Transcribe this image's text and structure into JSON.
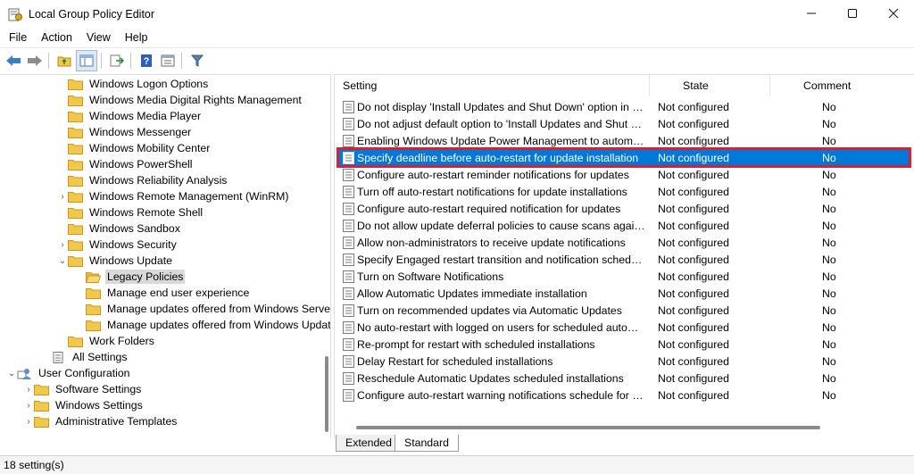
{
  "window": {
    "title": "Local Group Policy Editor"
  },
  "menu": [
    "File",
    "Action",
    "View",
    "Help"
  ],
  "toolbar": {
    "icons": [
      "back-icon",
      "forward-icon",
      "up-folder-icon",
      "show-hide-tree-icon",
      "export-list-icon",
      "help-icon",
      "properties-icon",
      "filter-icon"
    ]
  },
  "tree": {
    "items": [
      {
        "label": "Windows Logon Options",
        "expander": ""
      },
      {
        "label": "Windows Media Digital Rights Management",
        "expander": ""
      },
      {
        "label": "Windows Media Player",
        "expander": ""
      },
      {
        "label": "Windows Messenger",
        "expander": ""
      },
      {
        "label": "Windows Mobility Center",
        "expander": ""
      },
      {
        "label": "Windows PowerShell",
        "expander": ""
      },
      {
        "label": "Windows Reliability Analysis",
        "expander": ""
      },
      {
        "label": "Windows Remote Management (WinRM)",
        "expander": "›"
      },
      {
        "label": "Windows Remote Shell",
        "expander": ""
      },
      {
        "label": "Windows Sandbox",
        "expander": ""
      },
      {
        "label": "Windows Security",
        "expander": "›"
      },
      {
        "label": "Windows Update",
        "expander": "⌄"
      },
      {
        "label": "Legacy Policies",
        "expander": ""
      },
      {
        "label": "Manage end user experience",
        "expander": ""
      },
      {
        "label": "Manage updates offered from Windows Server Update Service",
        "expander": ""
      },
      {
        "label": "Manage updates offered from Windows Update",
        "expander": ""
      },
      {
        "label": "Work Folders",
        "expander": ""
      },
      {
        "label": "All Settings",
        "expander": ""
      },
      {
        "label": "User Configuration",
        "expander": "⌄"
      },
      {
        "label": "Software Settings",
        "expander": "›"
      },
      {
        "label": "Windows Settings",
        "expander": "›"
      },
      {
        "label": "Administrative Templates",
        "expander": "›"
      }
    ]
  },
  "table": {
    "headers": {
      "setting": "Setting",
      "state": "State",
      "comment": "Comment"
    },
    "rows": [
      {
        "name": "Do not display 'Install Updates and Shut Down' option in Sh...",
        "state": "Not configured",
        "comment": "No"
      },
      {
        "name": "Do not adjust default option to 'Install Updates and Shut Do...",
        "state": "Not configured",
        "comment": "No"
      },
      {
        "name": "Enabling Windows Update Power Management to automati...",
        "state": "Not configured",
        "comment": "No"
      },
      {
        "name": "Specify deadline before auto-restart for update installation",
        "state": "Not configured",
        "comment": "No"
      },
      {
        "name": "Configure auto-restart reminder notifications for updates",
        "state": "Not configured",
        "comment": "No"
      },
      {
        "name": "Turn off auto-restart notifications for update installations",
        "state": "Not configured",
        "comment": "No"
      },
      {
        "name": "Configure auto-restart required notification for updates",
        "state": "Not configured",
        "comment": "No"
      },
      {
        "name": "Do not allow update deferral policies to cause scans against ...",
        "state": "Not configured",
        "comment": "No"
      },
      {
        "name": "Allow non-administrators to receive update notifications",
        "state": "Not configured",
        "comment": "No"
      },
      {
        "name": "Specify Engaged restart transition and notification schedule ...",
        "state": "Not configured",
        "comment": "No"
      },
      {
        "name": "Turn on Software Notifications",
        "state": "Not configured",
        "comment": "No"
      },
      {
        "name": "Allow Automatic Updates immediate installation",
        "state": "Not configured",
        "comment": "No"
      },
      {
        "name": "Turn on recommended updates via Automatic Updates",
        "state": "Not configured",
        "comment": "No"
      },
      {
        "name": "No auto-restart with logged on users for scheduled automat...",
        "state": "Not configured",
        "comment": "No"
      },
      {
        "name": "Re-prompt for restart with scheduled installations",
        "state": "Not configured",
        "comment": "No"
      },
      {
        "name": "Delay Restart for scheduled installations",
        "state": "Not configured",
        "comment": "No"
      },
      {
        "name": "Reschedule Automatic Updates scheduled installations",
        "state": "Not configured",
        "comment": "No"
      },
      {
        "name": "Configure auto-restart warning notifications schedule for u...",
        "state": "Not configured",
        "comment": "No"
      }
    ]
  },
  "tabs": [
    "Extended",
    "Standard"
  ],
  "status": {
    "text": "18 setting(s)"
  },
  "colors": {
    "selection": "#0078d7",
    "highlight_border": "#d32238",
    "folder": "#f2c84b"
  }
}
